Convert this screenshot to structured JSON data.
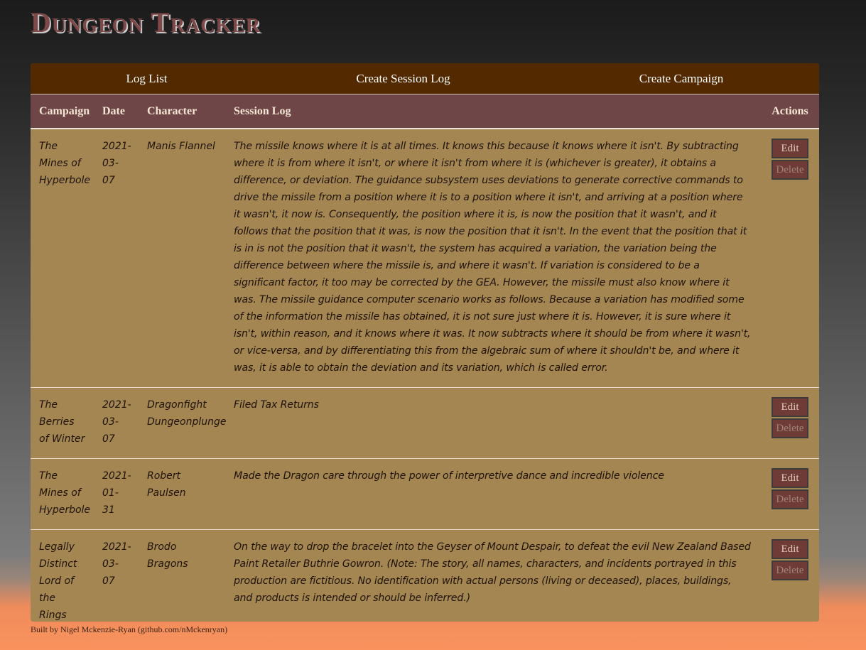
{
  "app": {
    "title": "Dungeon Tracker"
  },
  "nav": {
    "items": [
      "Log List",
      "Create Session Log",
      "Create Campaign"
    ]
  },
  "table": {
    "headers": {
      "campaign": "Campaign",
      "date": "Date",
      "character": "Character",
      "session_log": "Session Log",
      "actions": "Actions"
    },
    "edit_label": "Edit",
    "delete_label": "Delete",
    "rows": [
      {
        "campaign": "The Mines of Hyperbole",
        "date": "2021-03-07",
        "character": "Manis Flannel",
        "session_log": "The missile knows where it is at all times. It knows this because it knows where it isn't. By subtracting where it is from where it isn't, or where it isn't from where it is (whichever is greater), it obtains a difference, or deviation. The guidance subsystem uses deviations to generate corrective commands to drive the missile from a position where it is to a position where it isn't, and arriving at a position where it wasn't, it now is. Consequently, the position where it is, is now the position that it wasn't, and it follows that the position that it was, is now the position that it isn't. In the event that the position that it is in is not the position that it wasn't, the system has acquired a variation, the variation being the difference between where the missile is, and where it wasn't. If variation is considered to be a significant factor, it too may be corrected by the GEA. However, the missile must also know where it was. The missile guidance computer scenario works as follows. Because a variation has modified some of the information the missile has obtained, it is not sure just where it is. However, it is sure where it isn't, within reason, and it knows where it was. It now subtracts where it should be from where it wasn't, or vice-versa, and by differentiating this from the algebraic sum of where it shouldn't be, and where it was, it is able to obtain the deviation and its variation, which is called error."
      },
      {
        "campaign": "The Berries of Winter",
        "date": "2021-03-07",
        "character": "Dragonfight Dungeonplunge",
        "session_log": "Filed Tax Returns"
      },
      {
        "campaign": "The Mines of Hyperbole",
        "date": "2021-01-31",
        "character": "Robert Paulsen",
        "session_log": "Made the Dragon care through the power of interpretive dance and incredible violence"
      },
      {
        "campaign": "Legally Distinct Lord of the Rings",
        "date": "2021-03-07",
        "character": "Brodo Bragons",
        "session_log": "On the way to drop the bracelet into the Geyser of Mount Despair, to defeat the evil New Zealand Based Paint Retailer Buthrie Gowron. (Note: The story, all names, characters, and incidents portrayed in this production are fictitious. No identification with actual persons (living or deceased), places, buildings, and products is intended or should be inferred.)"
      }
    ]
  },
  "footer": {
    "text": "Built by Nigel Mckenzie-Ryan (github.com/nMckenryan)"
  }
}
